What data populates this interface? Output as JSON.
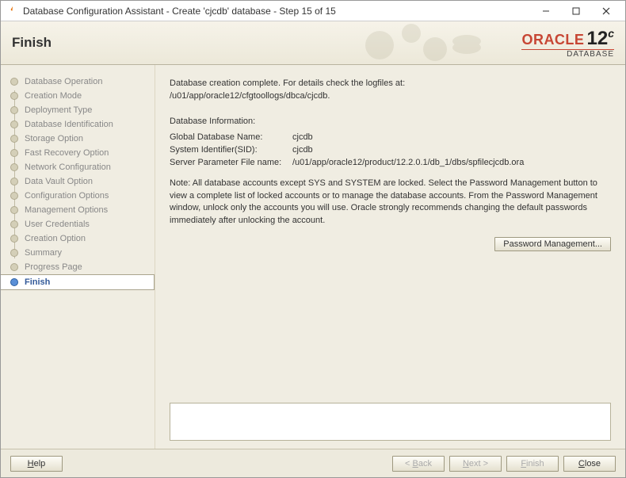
{
  "window": {
    "title": "Database Configuration Assistant - Create 'cjcdb' database - Step 15 of 15"
  },
  "header": {
    "title": "Finish",
    "brand_top": "ORACLE",
    "brand_version": "12",
    "brand_suffix": "c",
    "brand_sub": "DATABASE"
  },
  "sidebar": {
    "items": [
      {
        "label": "Database Operation"
      },
      {
        "label": "Creation Mode"
      },
      {
        "label": "Deployment Type"
      },
      {
        "label": "Database Identification"
      },
      {
        "label": "Storage Option"
      },
      {
        "label": "Fast Recovery Option"
      },
      {
        "label": "Network Configuration"
      },
      {
        "label": "Data Vault Option"
      },
      {
        "label": "Configuration Options"
      },
      {
        "label": "Management Options"
      },
      {
        "label": "User Credentials"
      },
      {
        "label": "Creation Option"
      },
      {
        "label": "Summary"
      },
      {
        "label": "Progress Page"
      },
      {
        "label": "Finish"
      }
    ],
    "active_index": 14
  },
  "content": {
    "complete_msg": "Database creation complete. For details check the logfiles at:",
    "log_path": " /u01/app/oracle12/cfgtoollogs/dbca/cjcdb.",
    "info_header": "Database Information:",
    "global_name_label": "Global Database Name:",
    "global_name_value": "cjcdb",
    "sid_label": "System Identifier(SID):",
    "sid_value": "cjcdb",
    "spfile_label": "Server Parameter File name:",
    "spfile_value": "/u01/app/oracle12/product/12.2.0.1/db_1/dbs/spfilecjcdb.ora",
    "note": "Note: All database accounts except SYS and SYSTEM are locked. Select the Password Management button to view a complete list of locked accounts or to manage the database accounts. From the Password Management window, unlock only the accounts you will use. Oracle strongly recommends changing the default passwords immediately after unlocking the account.",
    "pwd_btn_label": "Password Management..."
  },
  "footer": {
    "help_label": "Help",
    "back_label": "< Back",
    "next_label": "Next >",
    "finish_label": "Finish",
    "close_label": "Close"
  }
}
